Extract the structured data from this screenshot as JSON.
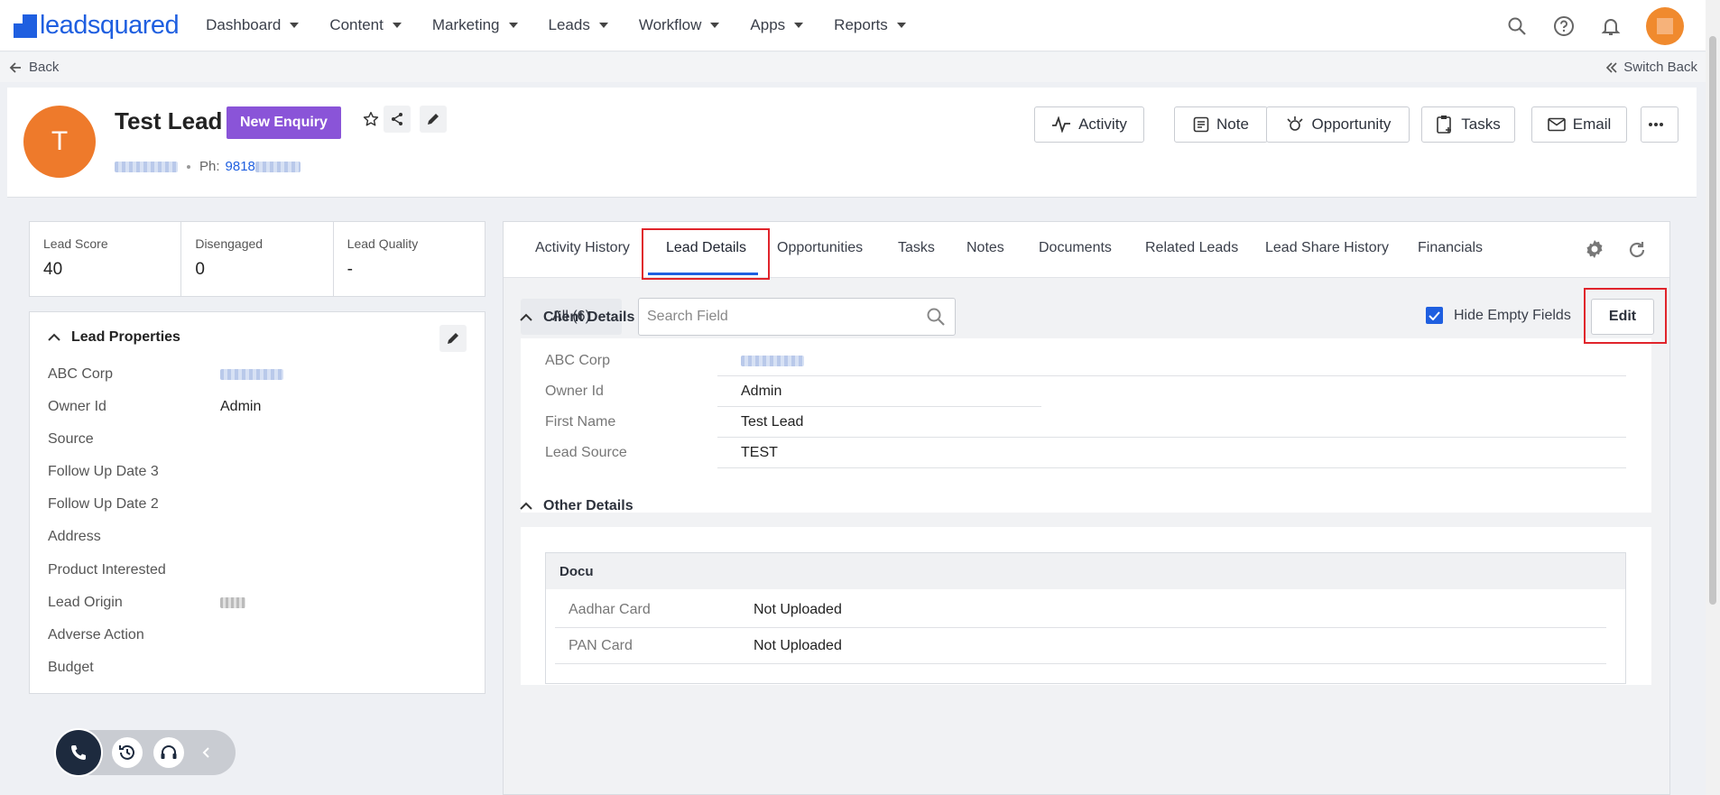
{
  "app": {
    "brand": "leadsquared",
    "accent": "#1f5fe0",
    "badge_color": "#8a54d8"
  },
  "nav": {
    "items": [
      "Dashboard",
      "Content",
      "Marketing",
      "Leads",
      "Workflow",
      "Apps",
      "Reports"
    ],
    "icons": [
      "search-icon",
      "help-icon",
      "bell-icon",
      "user-avatar"
    ]
  },
  "backbar": {
    "back": "Back",
    "switch_back": "Switch Back"
  },
  "lead": {
    "initial": "T",
    "name": "Test Lead",
    "stage": "New Enquiry",
    "phone_label": "Ph:",
    "phone_visible": "9818"
  },
  "actions": [
    "Activity",
    "Note",
    "Opportunity",
    "Tasks",
    "Email"
  ],
  "metrics": [
    {
      "label": "Lead Score",
      "value": "40"
    },
    {
      "label": "Disengaged",
      "value": "0"
    },
    {
      "label": "Lead Quality",
      "value": "-"
    }
  ],
  "properties": {
    "title": "Lead Properties",
    "rows": [
      {
        "label": "ABC Corp",
        "value": ""
      },
      {
        "label": "Owner Id",
        "value": "Admin"
      },
      {
        "label": "Source",
        "value": ""
      },
      {
        "label": "Follow Up Date 3",
        "value": ""
      },
      {
        "label": "Follow Up Date 2",
        "value": ""
      },
      {
        "label": "Address",
        "value": ""
      },
      {
        "label": "Product Interested",
        "value": ""
      },
      {
        "label": "Lead Origin",
        "value": ""
      },
      {
        "label": "Adverse Action",
        "value": ""
      },
      {
        "label": "Budget",
        "value": ""
      }
    ]
  },
  "tabs": [
    "Activity History",
    "Lead Details",
    "Opportunities",
    "Tasks",
    "Notes",
    "Documents",
    "Related Leads",
    "Lead Share History",
    "Financials"
  ],
  "active_tab": "Lead Details",
  "details": {
    "all_label": "All (6)",
    "search_placeholder": "Search Field",
    "hide_empty": "Hide Empty Fields",
    "hide_empty_checked": true,
    "edit": "Edit",
    "client_section": "Client Details",
    "client_rows": [
      {
        "label": "ABC Corp",
        "value": ""
      },
      {
        "label": "Owner Id",
        "value": "Admin"
      },
      {
        "label": "First Name",
        "value": "Test Lead"
      },
      {
        "label": "Lead Source",
        "value": "TEST"
      }
    ],
    "other_section": "Other Details",
    "docu_title": "Docu",
    "docu_rows": [
      {
        "label": "Aadhar Card",
        "value": "Not Uploaded"
      },
      {
        "label": "PAN Card",
        "value": "Not Uploaded"
      }
    ]
  }
}
